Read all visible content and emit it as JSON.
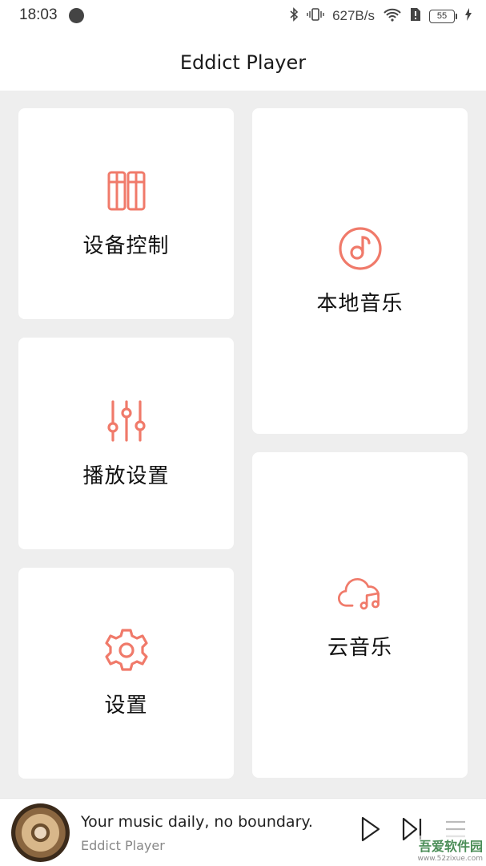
{
  "status_bar": {
    "time": "18:03",
    "net_speed": "627B/s",
    "battery": "55",
    "icons": [
      "notification-icon",
      "bluetooth-icon",
      "vibrate-icon",
      "wifi-icon",
      "no-sim-icon",
      "battery-icon",
      "charging-icon"
    ]
  },
  "header": {
    "title": "Eddict Player"
  },
  "accent_color": "#f07a6a",
  "cards": {
    "device_control": {
      "label": "设备控制",
      "icon": "sliders-panel-icon"
    },
    "local_music": {
      "label": "本地音乐",
      "icon": "music-note-disc-icon"
    },
    "playback_settings": {
      "label": "播放设置",
      "icon": "equalizer-icon"
    },
    "cloud_music": {
      "label": "云音乐",
      "icon": "cloud-music-icon"
    },
    "settings": {
      "label": "设置",
      "icon": "gear-icon"
    }
  },
  "player": {
    "title": "Your music daily, no boundary.",
    "artist": "Eddict Player"
  },
  "watermark": {
    "name": "吾爱软件园",
    "url": "www.52zixue.com"
  }
}
